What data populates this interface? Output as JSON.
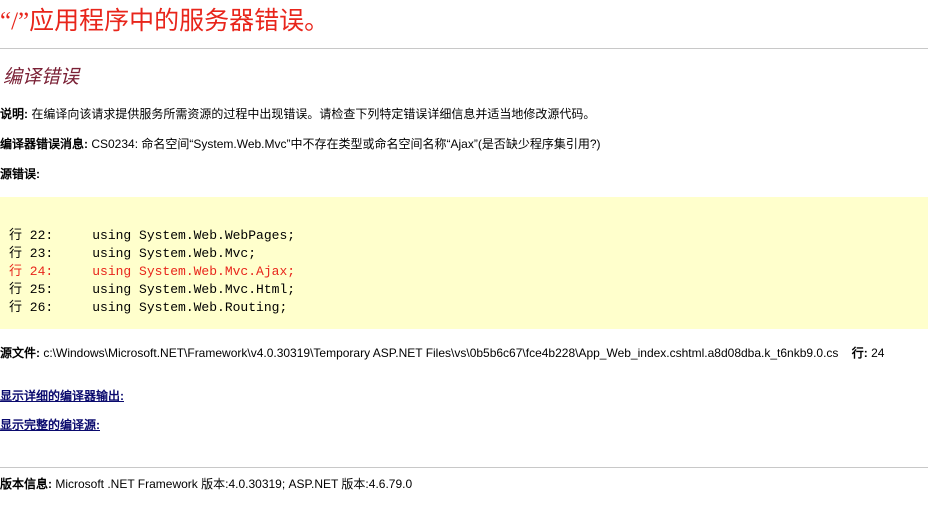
{
  "page_title": "“/”应用程序中的服务器错误。",
  "error_heading": "编译错误",
  "description": {
    "label": "说明:",
    "text": " 在编译向该请求提供服务所需资源的过程中出现错误。请检查下列特定错误详细信息并适当地修改源代码。"
  },
  "compiler_message": {
    "label": "编译器错误消息:",
    "text": " CS0234: 命名空间“System.Web.Mvc”中不存在类型或命名空间名称“Ajax”(是否缺少程序集引用?)"
  },
  "source_error_label": "源错误:",
  "source_lines": [
    {
      "text": "行 22:     using System.Web.WebPages;",
      "highlight": false
    },
    {
      "text": "行 23:     using System.Web.Mvc;",
      "highlight": false
    },
    {
      "text": "行 24:     using System.Web.Mvc.Ajax;",
      "highlight": true
    },
    {
      "text": "行 25:     using System.Web.Mvc.Html;",
      "highlight": false
    },
    {
      "text": "行 26:     using System.Web.Routing;",
      "highlight": false
    }
  ],
  "source_file": {
    "label": "源文件:",
    "path": " c:\\Windows\\Microsoft.NET\\Framework\\v4.0.30319\\Temporary ASP.NET Files\\vs\\0b5b6c67\\fce4b228\\App_Web_index.cshtml.a8d08dba.k_t6nkb9.0.cs",
    "line_label": "行:",
    "line_value": " 24"
  },
  "links": {
    "show_compiler_output": "显示详细的编译器输出:",
    "show_complete_source": "显示完整的编译源:"
  },
  "version_info": {
    "label": "版本信息:",
    "text": " Microsoft .NET Framework 版本:4.0.30319; ASP.NET 版本:4.6.79.0"
  },
  "colors": {
    "title": "#e8251b",
    "heading": "#7a2035",
    "code_background": "#ffffcc",
    "error_line": "#e8251b",
    "link": "#0a0a6e"
  }
}
